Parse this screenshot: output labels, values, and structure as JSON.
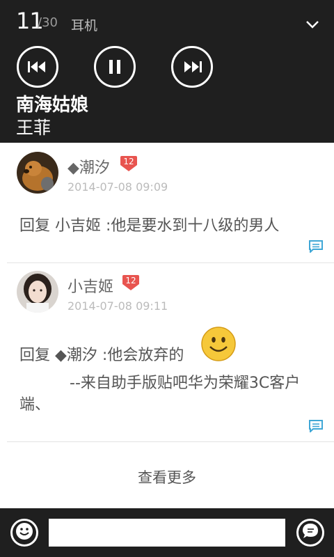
{
  "media": {
    "position": "11",
    "total": "/30",
    "output": "耳机",
    "song_title": "南海姑娘",
    "artist": "王菲",
    "controls": [
      "previous-icon",
      "pause-icon",
      "next-icon"
    ],
    "collapse_icon": "chevron-down-icon"
  },
  "posts": [
    {
      "username": "◆潮汐",
      "level": "12",
      "time": "2014-07-08 09:09",
      "body": "回复 小吉姬 :他是要水到十八级的男人"
    },
    {
      "username": "小吉姬",
      "level": "12",
      "time": "2014-07-08 09:11",
      "body": "回复 ◆潮汐 :他会放弃的",
      "signature_line1": "--来自助手版贴吧华为荣耀3C客户",
      "signature_line2": "端、"
    }
  ],
  "load_more": "查看更多",
  "composer": {
    "emoji_icon": "smiley-icon",
    "input_value": "",
    "send_icon": "send-icon"
  },
  "colors": {
    "dark_bar": "#1f1f1f",
    "level_badge": "#e8544f",
    "reply_icon": "#3fa7d6"
  }
}
